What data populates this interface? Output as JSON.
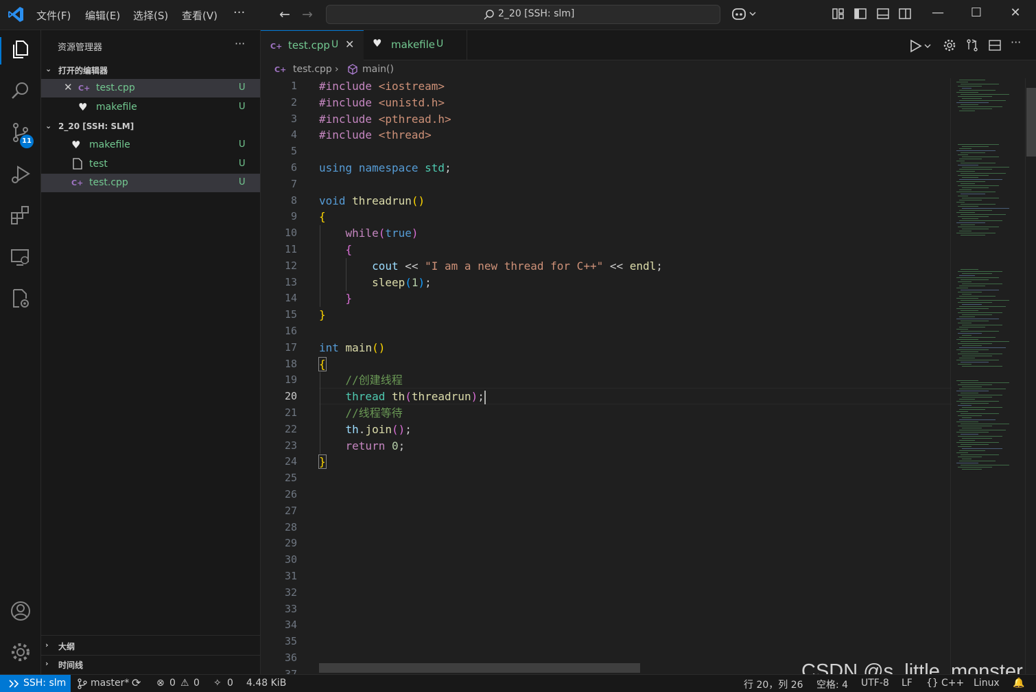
{
  "titlebar": {
    "menu": [
      "文件(F)",
      "编辑(E)",
      "选择(S)",
      "查看(V)"
    ],
    "menu_more": "···",
    "search_text": "2_20 [SSH: slm]"
  },
  "activity": {
    "source_control_badge": "11"
  },
  "sidebar": {
    "title": "资源管理器",
    "more": "···",
    "open_editors_header": "打开的编辑器",
    "open_editors": [
      {
        "name": "test.cpp",
        "status": "U"
      },
      {
        "name": "makefile",
        "status": "U"
      }
    ],
    "folder_header": "2_20 [SSH: SLM]",
    "files": [
      {
        "name": "makefile",
        "status": "U"
      },
      {
        "name": "test",
        "status": "U"
      },
      {
        "name": "test.cpp",
        "status": "U"
      }
    ],
    "outline_header": "大纲",
    "timeline_header": "时间线"
  },
  "tabs": [
    {
      "name": "test.cpp",
      "status": "U"
    },
    {
      "name": "makefile",
      "status": "U"
    }
  ],
  "breadcrumb": {
    "file": "test.cpp",
    "symbol": "main()"
  },
  "editor": {
    "current_line": 20,
    "line_count": 37,
    "lines": [
      "#include <iostream>",
      "#include <unistd.h>",
      "#include <pthread.h>",
      "#include <thread>",
      "",
      "using namespace std;",
      "",
      "void threadrun()",
      "{",
      "    while(true)",
      "    {",
      "        cout << \"I am a new thread for C++\" << endl;",
      "        sleep(1);",
      "    }",
      "}",
      "",
      "int main()",
      "{",
      "    //创建线程",
      "    thread th(threadrun);",
      "    //线程等待",
      "    th.join();",
      "    return 0;",
      "}"
    ]
  },
  "statusbar": {
    "remote": "SSH: slm",
    "branch": "master*",
    "errors": "0",
    "warnings": "0",
    "ports": "0",
    "size": "4.48 KiB",
    "position": "行 20，列 26",
    "spaces": "空格: 4",
    "encoding": "UTF-8",
    "eol": "LF",
    "language": "C++",
    "os": "Linux"
  },
  "watermark": "CSDN @s_little_monster",
  "colors": {
    "accent": "#0078d4",
    "untracked": "#73c991",
    "background": "#1f1f1f"
  }
}
